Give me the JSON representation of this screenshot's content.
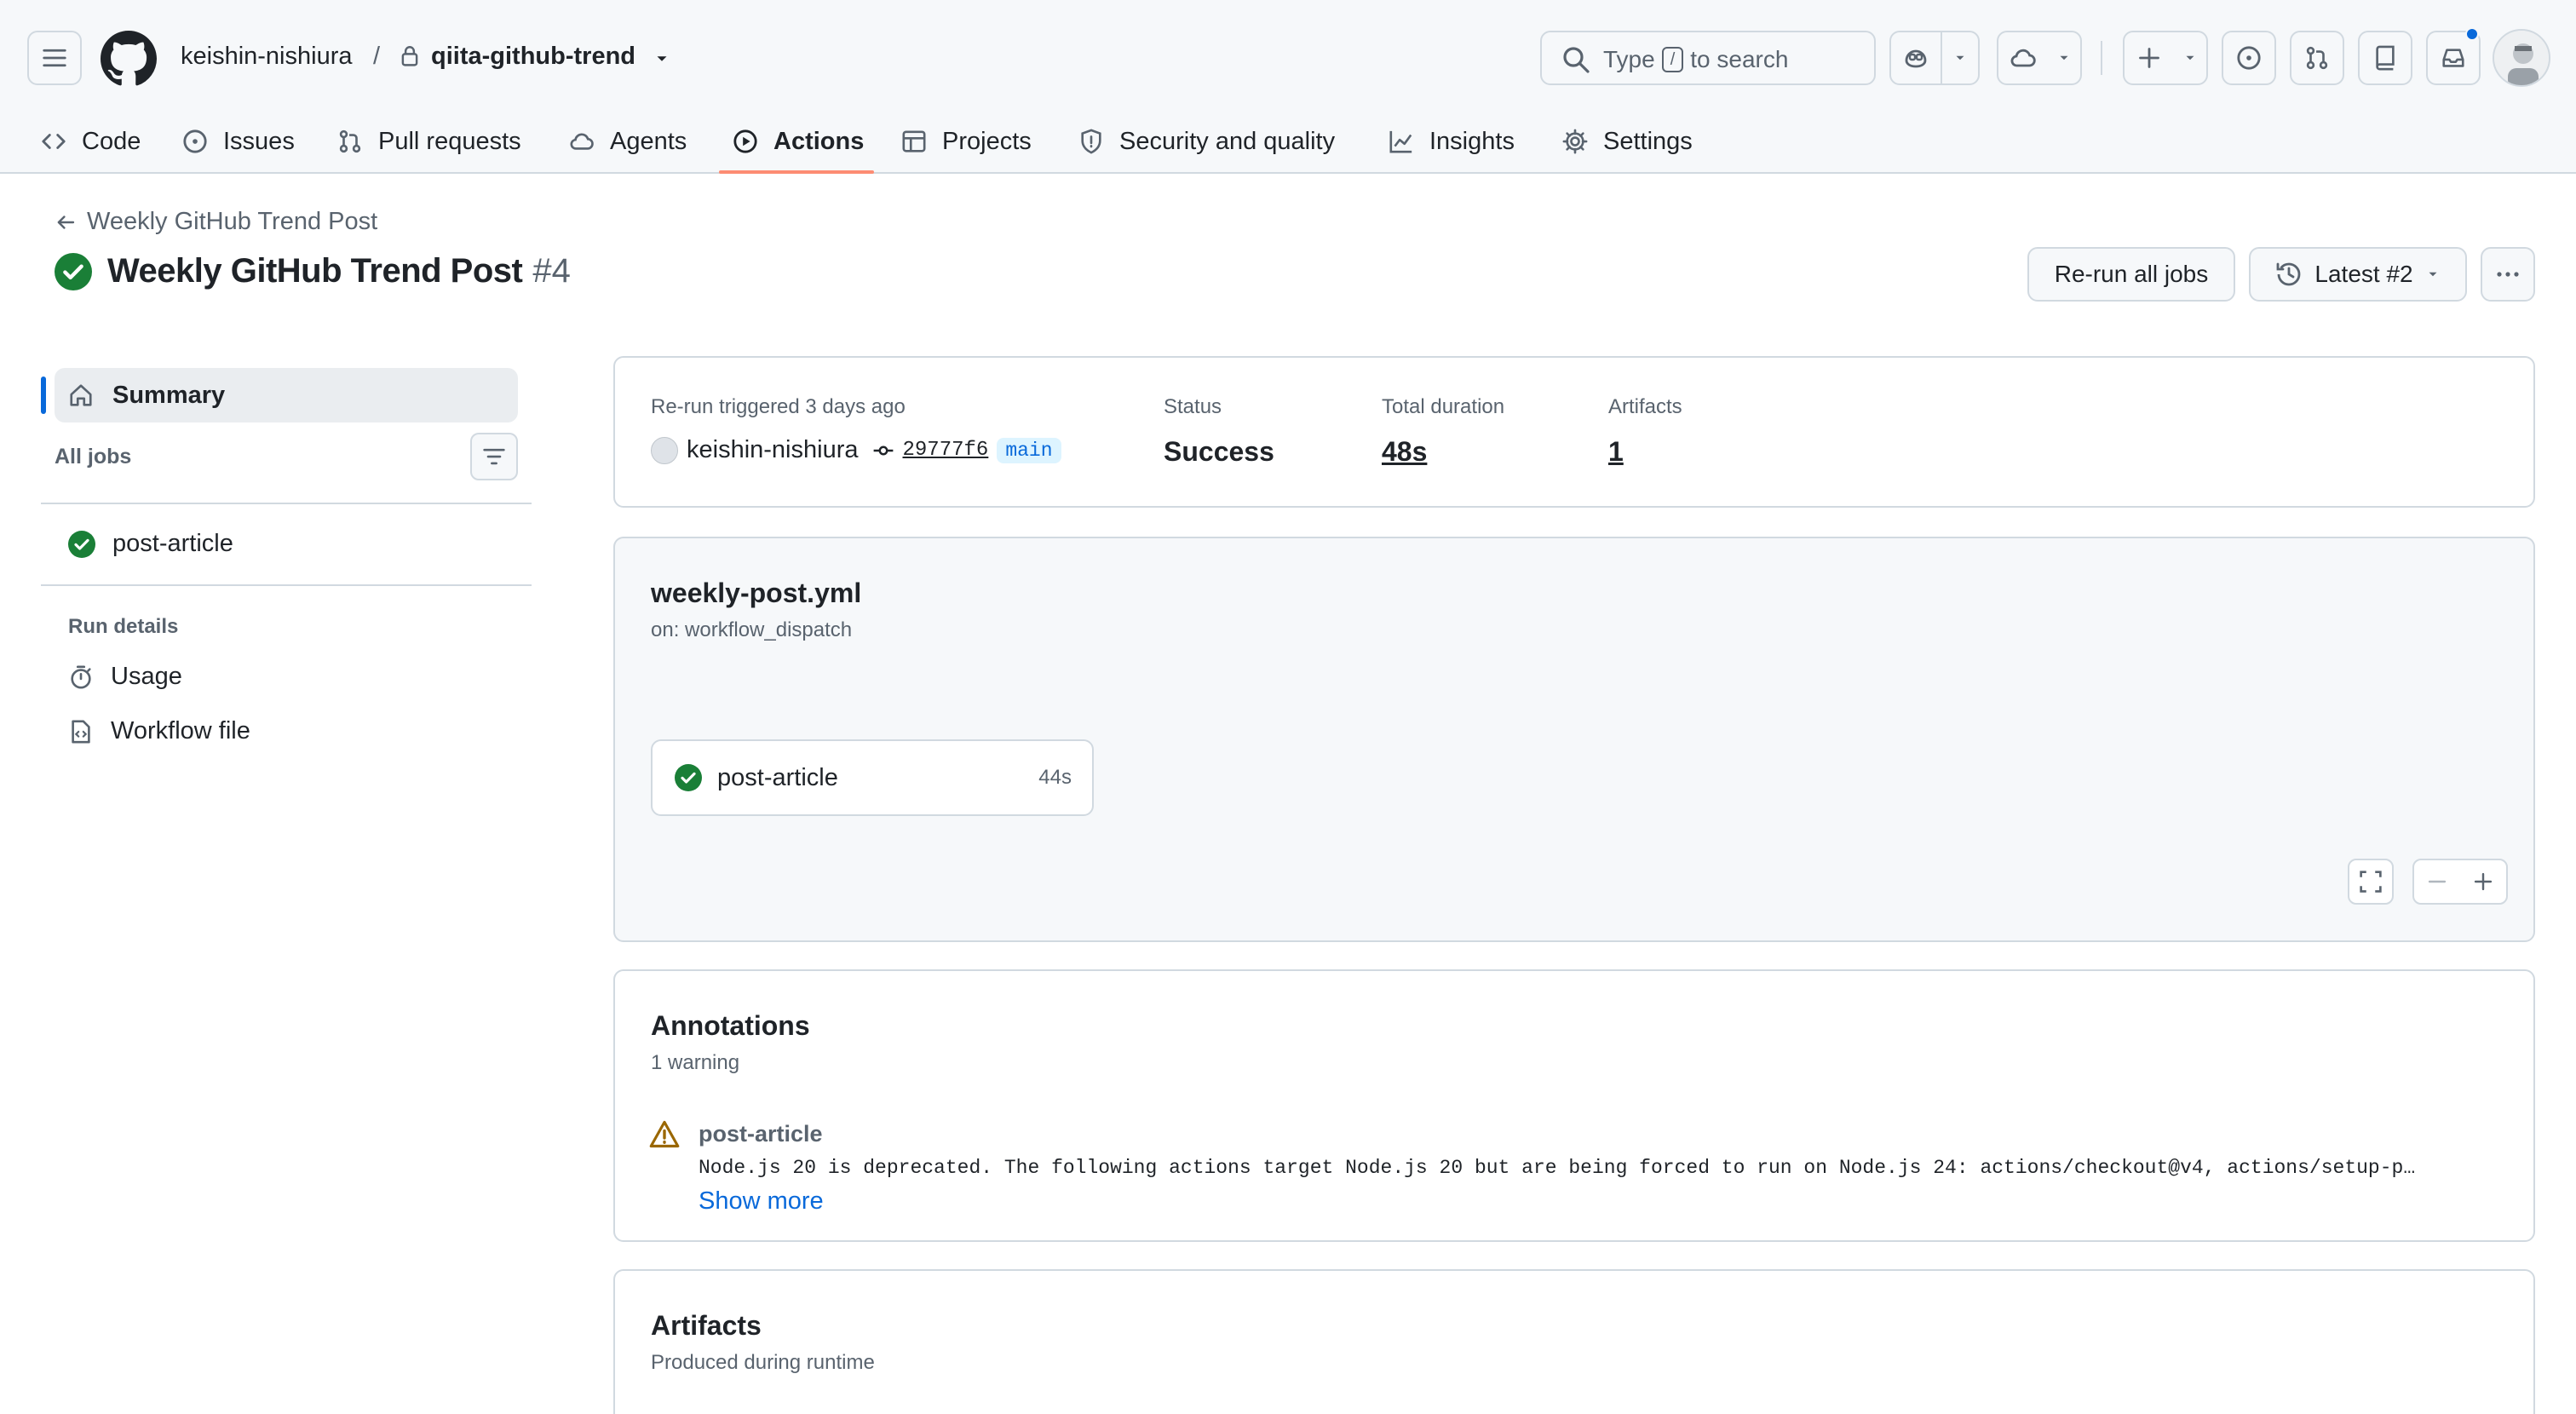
{
  "header": {
    "owner": "keishin-nishiura",
    "separator": "/",
    "repo": "qiita-github-trend",
    "search": {
      "prefix": "Type",
      "key": "/",
      "suffix": "to search"
    }
  },
  "nav": {
    "tabs": [
      {
        "label": "Code",
        "icon": "code-icon"
      },
      {
        "label": "Issues",
        "icon": "issue-opened-icon"
      },
      {
        "label": "Pull requests",
        "icon": "git-pull-request-icon"
      },
      {
        "label": "Agents",
        "icon": "agents-icon"
      },
      {
        "label": "Actions",
        "icon": "play-icon",
        "selected": true
      },
      {
        "label": "Projects",
        "icon": "table-icon"
      },
      {
        "label": "Security and quality",
        "icon": "shield-icon"
      },
      {
        "label": "Insights",
        "icon": "graph-icon"
      },
      {
        "label": "Settings",
        "icon": "gear-icon"
      }
    ]
  },
  "run": {
    "back_label": "Weekly GitHub Trend Post",
    "title": "Weekly GitHub Trend Post",
    "number": "#4",
    "status_icon": "check-circle-fill-icon",
    "rerun_label": "Re-run all jobs",
    "latest_label": "Latest #2"
  },
  "sidebar": {
    "summary_label": "Summary",
    "all_jobs_label": "All jobs",
    "jobs": [
      {
        "label": "post-article",
        "status": "success"
      }
    ],
    "run_details_label": "Run details",
    "details": [
      {
        "label": "Usage",
        "icon": "stopwatch-icon"
      },
      {
        "label": "Workflow file",
        "icon": "file-code-icon"
      }
    ]
  },
  "summary": {
    "trigger_label": "Re-run triggered 3 days ago",
    "actor": "keishin-nishiura",
    "sha": "29777f6",
    "branch": "main",
    "status_label": "Status",
    "status_value": "Success",
    "duration_label": "Total duration",
    "duration_value": "48s",
    "artifacts_label": "Artifacts",
    "artifacts_value": "1"
  },
  "workflow": {
    "file": "weekly-post.yml",
    "trigger": "on: workflow_dispatch",
    "job": {
      "name": "post-article",
      "duration": "44s"
    }
  },
  "annotations": {
    "title": "Annotations",
    "subtitle": "1 warning",
    "items": [
      {
        "job": "post-article",
        "message": "Node.js 20 is deprecated. The following actions target Node.js 20 but are being forced to run on Node.js 24: actions/checkout@v4, actions/setup-p…",
        "show_more": "Show more"
      }
    ]
  },
  "artifacts": {
    "title": "Artifacts",
    "subtitle": "Produced during runtime"
  },
  "colors": {
    "success": "#1a7f37",
    "accent_blue": "#0969da",
    "tab_underline": "#fd8c73",
    "warning": "#9a6700",
    "border": "#d1d9e0",
    "muted": "#59636e"
  }
}
